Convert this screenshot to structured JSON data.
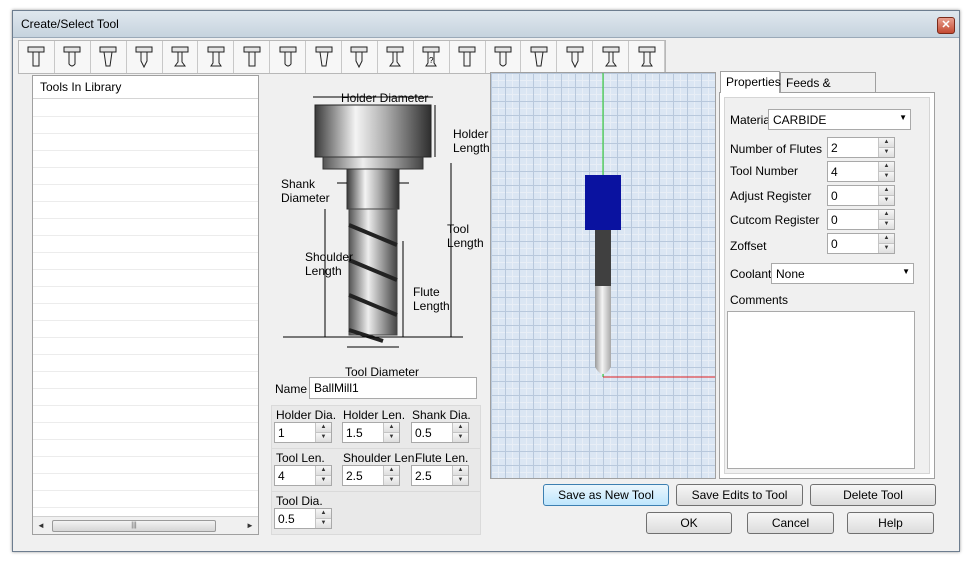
{
  "window": {
    "title": "Create/Select Tool",
    "close_glyph": "✕"
  },
  "toolbar": {
    "icons": [
      "flat-endmill-icon",
      "bull-endmill-icon",
      "ball-endmill-icon",
      "chamfer-tool-icon",
      "drill-icon",
      "taper-endmill-icon",
      "thread-mill-icon",
      "slot-cutter-icon",
      "dovetail-icon",
      "countersink-icon",
      "spot-drill-icon",
      "custom-tool-icon",
      "engraving-tool-icon",
      "reamer-icon",
      "tap-icon",
      "boring-bar-icon",
      "lollipop-cutter-icon",
      "form-tool-icon"
    ],
    "custom_glyph": "?"
  },
  "library": {
    "header": "Tools In Library",
    "scroll_left": "◄",
    "scroll_right": "►",
    "scroll_grip": "|||"
  },
  "diagram": {
    "holder_diameter": "Holder Diameter",
    "holder_length": "Holder\nLength",
    "shank_diameter": "Shank\nDiameter",
    "tool_length": "Tool\nLength",
    "shoulder_length": "Shoulder\nLength",
    "flute_length": "Flute\nLength",
    "tool_diameter": "Tool Diameter"
  },
  "name": {
    "label": "Name",
    "value": "BallMill1"
  },
  "params": {
    "holder_dia": {
      "label": "Holder Dia.",
      "value": "1"
    },
    "holder_len": {
      "label": "Holder Len.",
      "value": "1.5"
    },
    "shank_dia": {
      "label": "Shank Dia.",
      "value": "0.5"
    },
    "tool_len": {
      "label": "Tool Len.",
      "value": "4"
    },
    "shoulder_len": {
      "label": "Shoulder Len.",
      "value": "2.5"
    },
    "flute_len": {
      "label": "Flute Len.",
      "value": "2.5"
    },
    "tool_dia": {
      "label": "Tool Dia.",
      "value": "0.5"
    }
  },
  "spinner": {
    "up": "▲",
    "down": "▼"
  },
  "tabs": {
    "properties": "Properties",
    "feeds": "Feeds & Speeds"
  },
  "props": {
    "material_label": "Material",
    "material_value": "CARBIDE",
    "flutes_label": "Number of Flutes",
    "flutes_value": "2",
    "tool_number_label": "Tool Number",
    "tool_number_value": "4",
    "adjust_label": "Adjust Register",
    "adjust_value": "0",
    "cutcom_label": "Cutcom Register",
    "cutcom_value": "0",
    "zoffset_label": "Zoffset",
    "zoffset_value": "0",
    "coolant_label": "Coolant",
    "coolant_value": "None",
    "comments_label": "Comments",
    "dropdown_arrow": "▼"
  },
  "buttons": {
    "save_new": "Save as New Tool",
    "save_edits": "Save Edits to Tool",
    "delete": "Delete Tool",
    "ok": "OK",
    "cancel": "Cancel",
    "help": "Help"
  }
}
